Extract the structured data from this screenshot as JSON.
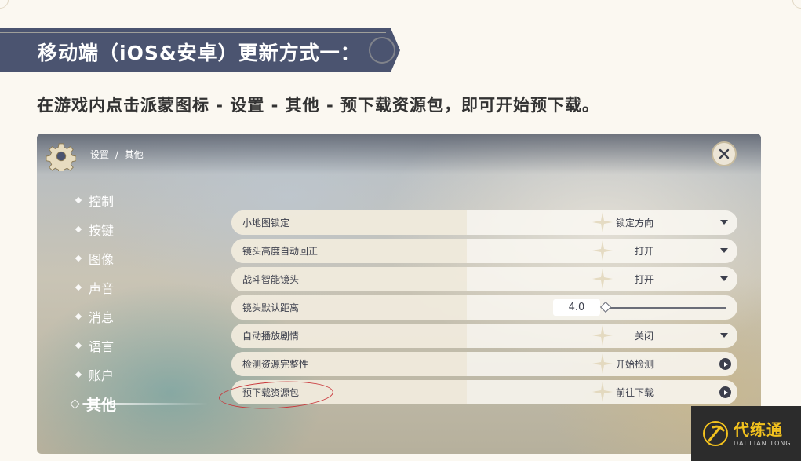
{
  "header": {
    "title": "移动端（iOS&安卓）更新方式一："
  },
  "instruction": "在游戏内点击派蒙图标 - 设置 - 其他 - 预下载资源包，即可开始预下载。",
  "game_settings": {
    "breadcrumb": {
      "parent": "设置",
      "separator": "/",
      "current": "其他"
    },
    "sidebar": {
      "items": [
        {
          "label": "控制"
        },
        {
          "label": "按键"
        },
        {
          "label": "图像"
        },
        {
          "label": "声音"
        },
        {
          "label": "消息"
        },
        {
          "label": "语言"
        },
        {
          "label": "账户"
        },
        {
          "label": "其他",
          "active": true
        }
      ]
    },
    "rows": [
      {
        "label": "小地图锁定",
        "value": "锁定方向",
        "control": "dropdown"
      },
      {
        "label": "镜头高度自动回正",
        "value": "打开",
        "control": "dropdown"
      },
      {
        "label": "战斗智能镜头",
        "value": "打开",
        "control": "dropdown"
      },
      {
        "label": "镜头默认距离",
        "value": "4.0",
        "control": "slider",
        "slider_fraction": 0.0
      },
      {
        "label": "自动播放剧情",
        "value": "关闭",
        "control": "dropdown"
      },
      {
        "label": "检测资源完整性",
        "value": "开始检测",
        "control": "action"
      },
      {
        "label": "预下载资源包",
        "value": "前往下载",
        "control": "action",
        "highlighted": true
      }
    ]
  },
  "watermark": {
    "name_cn": "代练通",
    "name_en": "DAI LIAN TONG"
  },
  "colors": {
    "banner": "#4b5470",
    "highlight_circle": "#c9363a",
    "logo_yellow": "#f3c21e"
  }
}
